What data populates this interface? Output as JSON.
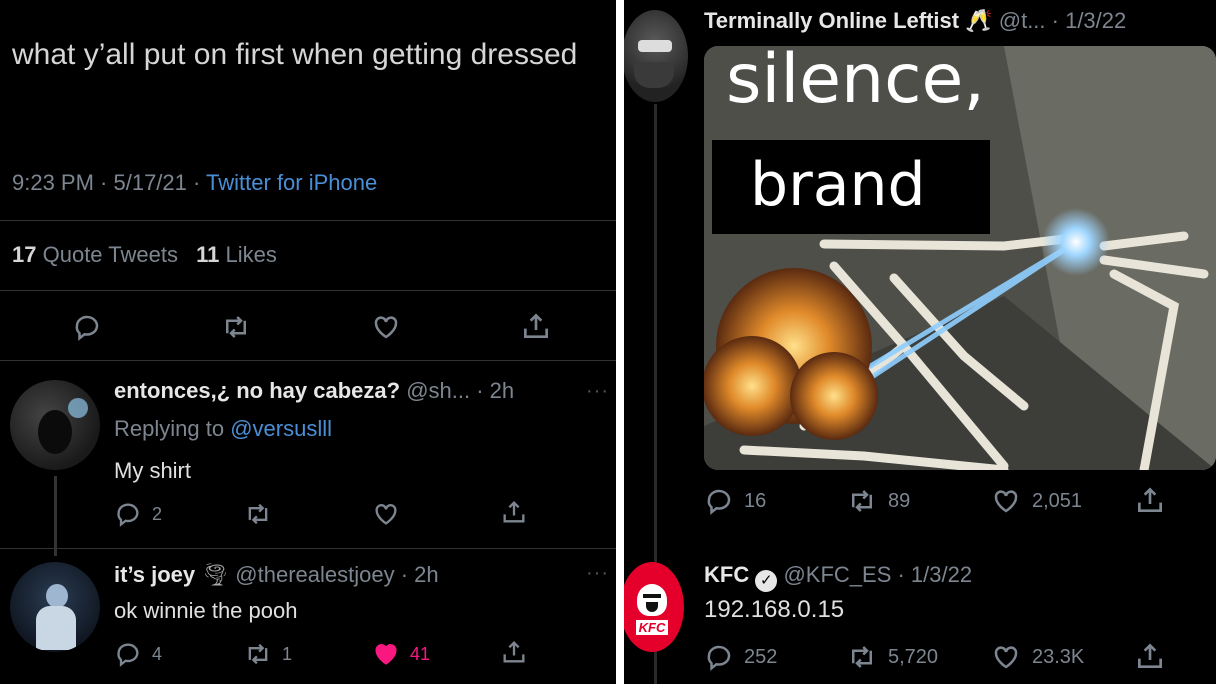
{
  "left_panel": {
    "main_tweet": {
      "text": "what y’all put on first when getting dressed",
      "time": "9:23 PM · 5/17/21 · ",
      "source": "Twitter for iPhone",
      "quote_count": "17",
      "quote_label": "Quote Tweets",
      "like_count": "11",
      "like_label": "Likes"
    },
    "replies": [
      {
        "name": "entonces,¿ no hay cabeza?",
        "handle": "@sh... · 2h",
        "replying_prefix": "Replying to ",
        "replying_to": "@versuslll",
        "text": "My shirt",
        "reply_count": "2",
        "retweet_count": "",
        "like_count": ""
      },
      {
        "name": "it’s joey",
        "emoji": "🌪",
        "handle": "@therealestjoey · 2h",
        "text": "ok winnie the pooh",
        "reply_count": "4",
        "retweet_count": "1",
        "like_count": "41"
      }
    ],
    "more_label": "···"
  },
  "right_panel": {
    "tweet1": {
      "name": "Terminally Online Leftist",
      "emoji": "🥂",
      "handle": "@t... · 1/3/22",
      "meme_top": "silence,",
      "meme_box": "brand",
      "reply_count": "16",
      "retweet_count": "89",
      "like_count": "2,051"
    },
    "tweet2": {
      "name": "KFC",
      "handle": "@KFC_ES · 1/3/22",
      "text": "192.168.0.15",
      "logo_text": "KFC",
      "reply_count": "252",
      "retweet_count": "5,720",
      "like_count": "23.3K"
    }
  },
  "colors": {
    "background": "#000000",
    "link_blue": "#4a8fd6",
    "muted": "#7d8690",
    "liked_pink": "#f91880",
    "kfc_red": "#e4002b"
  }
}
